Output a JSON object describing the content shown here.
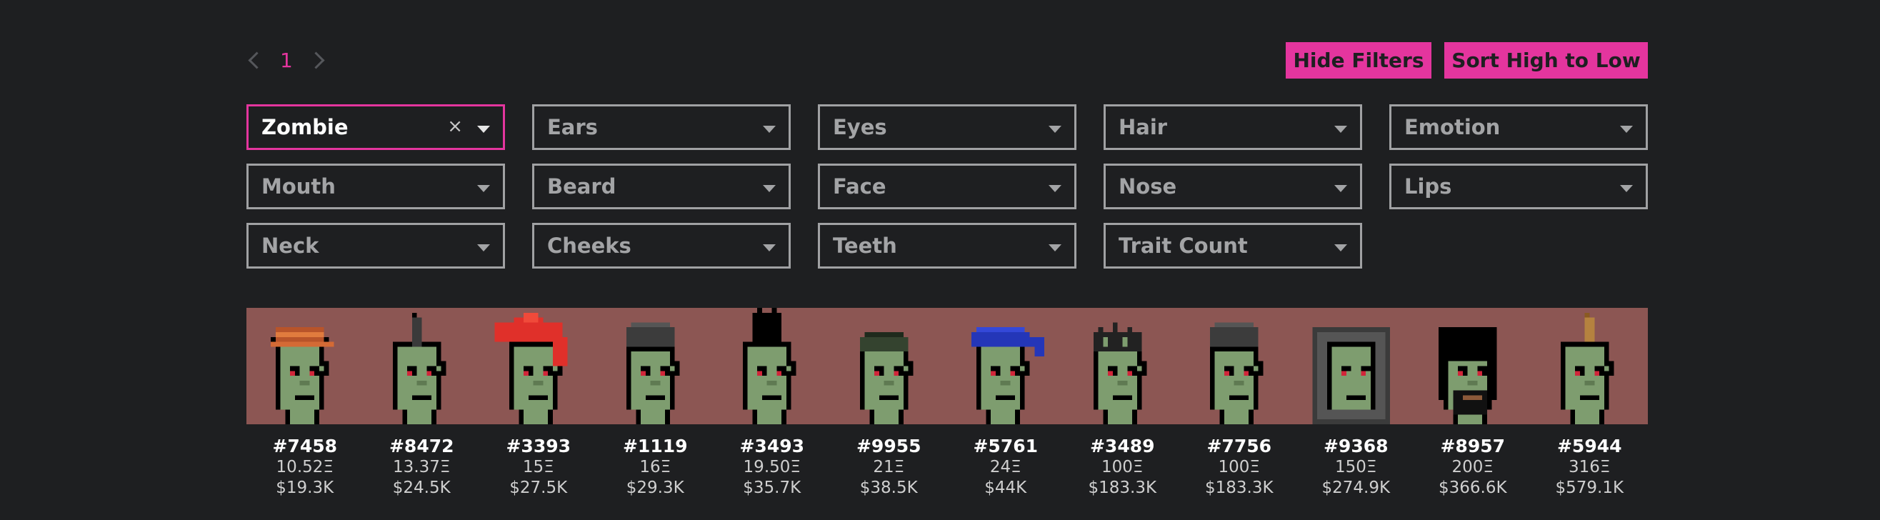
{
  "pagination": {
    "current_page": "1"
  },
  "toolbar": {
    "hide_filters": "Hide Filters",
    "sort": "Sort High to Low"
  },
  "filters": [
    {
      "label": "Zombie",
      "active": true
    },
    {
      "label": "Ears"
    },
    {
      "label": "Eyes"
    },
    {
      "label": "Hair"
    },
    {
      "label": "Emotion"
    },
    {
      "label": "Mouth"
    },
    {
      "label": "Beard"
    },
    {
      "label": "Face"
    },
    {
      "label": "Nose"
    },
    {
      "label": "Lips"
    },
    {
      "label": "Neck"
    },
    {
      "label": "Cheeks"
    },
    {
      "label": "Teeth"
    },
    {
      "label": "Trait Count"
    }
  ],
  "clear_glyph": "×",
  "colors": {
    "accent": "#e4359e",
    "background": "#1e1f21",
    "banner": "#8c5653",
    "zombie_skin": "#7e9d6f"
  },
  "items": [
    {
      "id": "#7458",
      "eth": "10.52Ξ",
      "usd": "$19.3K",
      "hat": "cap-orange"
    },
    {
      "id": "#8472",
      "eth": "13.37Ξ",
      "usd": "$24.5K",
      "hat": "mohawk-thin"
    },
    {
      "id": "#3393",
      "eth": "15Ξ",
      "usd": "$27.5K",
      "hat": "wild-red"
    },
    {
      "id": "#1119",
      "eth": "16Ξ",
      "usd": "$29.3K",
      "hat": "beanie-gray"
    },
    {
      "id": "#3493",
      "eth": "19.50Ξ",
      "usd": "$35.7K",
      "hat": "mohawk-black"
    },
    {
      "id": "#9955",
      "eth": "21Ξ",
      "usd": "$38.5K",
      "hat": "short-dark"
    },
    {
      "id": "#5761",
      "eth": "24Ξ",
      "usd": "$44K",
      "hat": "bandana-blue"
    },
    {
      "id": "#3489",
      "eth": "100Ξ",
      "usd": "$183.3K",
      "hat": "messy-dark"
    },
    {
      "id": "#7756",
      "eth": "100Ξ",
      "usd": "$183.3K",
      "hat": "beanie-gray"
    },
    {
      "id": "#9368",
      "eth": "150Ξ",
      "usd": "$274.9K",
      "hat": "hoodie"
    },
    {
      "id": "#8957",
      "eth": "200Ξ",
      "usd": "$366.6K",
      "hat": "long-black"
    },
    {
      "id": "#5944",
      "eth": "316Ξ",
      "usd": "$579.1K",
      "hat": "horn"
    }
  ]
}
